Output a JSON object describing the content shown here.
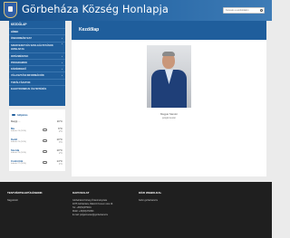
{
  "header": {
    "title": "Görbeháza Község Honlapja",
    "search_placeholder": "Keresés a weboldalon"
  },
  "sidebar": {
    "heading": "KEZDŐLAP",
    "items": [
      {
        "label": "HÍREK",
        "arrow": ""
      },
      {
        "label": "ÖNKORMÁNYZAT",
        "arrow": "›"
      },
      {
        "label": "SZERVEZETI ÉS SZOLGÁLTATÁSOK HONLAPJA",
        "arrow": "›"
      },
      {
        "label": "INTÉZMÉNYEK",
        "arrow": "›"
      },
      {
        "label": "PROGRAMOK",
        "arrow": "›"
      },
      {
        "label": "KÖZÉRDEKŰ",
        "arrow": "›"
      },
      {
        "label": "VÁLASZTÁSI INFORMÁCIÓK",
        "arrow": "›"
      },
      {
        "label": "TOPÁLYÁZATOK",
        "arrow": ""
      },
      {
        "label": "ELEKTRONIKUS ÜGYINTÉZÉS",
        "arrow": ""
      }
    ]
  },
  "weather": {
    "heading": "Időjárás",
    "today": {
      "label": "Ma(p) ...",
      "temp": "16°C"
    },
    "days": [
      {
        "day": "Ma",
        "date": "február 24 (2024)",
        "hi": "6°C",
        "lo": "2°C"
      },
      {
        "day": "Kedd",
        "date": "február 25 (2024)",
        "hi": "10°C",
        "lo": "3°C"
      },
      {
        "day": "Szerda",
        "date": "február 26 (2024)",
        "hi": "10°C",
        "lo": "2°C"
      },
      {
        "day": "Csütörtök",
        "date": "február 27 (2024)",
        "hi": "14°C",
        "lo": "4°C"
      }
    ]
  },
  "main": {
    "title": "Kezdőlap",
    "caption_name": "Magyar Sándor",
    "caption_role": "polgármester"
  },
  "footer": {
    "col1": {
      "heading": "TESTVÉRTELEPÜLÉSEINK",
      "lines": [
        "Nagyárodó"
      ]
    },
    "col2": {
      "heading": "KAPCSOLAT",
      "lines": [
        "Görbeháza Község Önkormányzata",
        "4075 Görbeháza, Rákóczi Ferenc utca 19.",
        "",
        "Tel: +36(52)375001",
        "Mobil: +36(30)371893",
        "E-mail: polgarmester@gorbehaza.hu"
      ]
    },
    "col3": {
      "heading": "KÖZI WEBOLDAL",
      "lines": [
        "buthc.gorbehaza.hu"
      ]
    }
  }
}
